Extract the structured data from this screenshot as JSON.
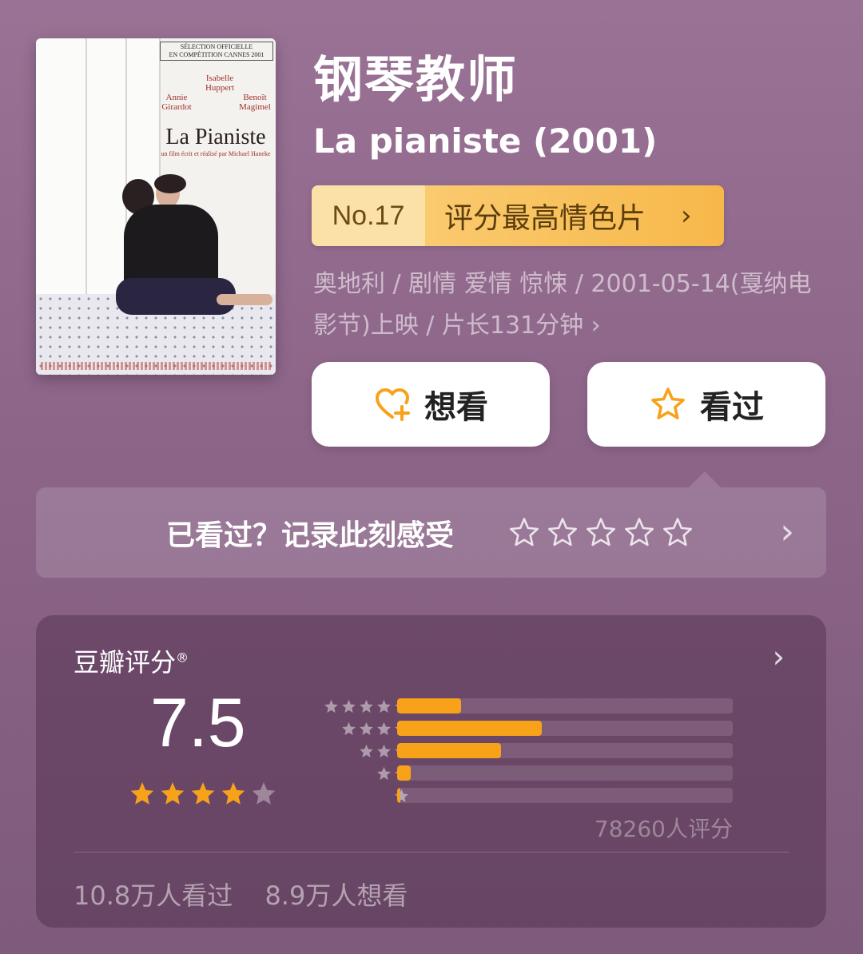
{
  "movie": {
    "title_cn": "钢琴教师",
    "title_original": "La pianiste (2001)",
    "rank_no": "No.17",
    "rank_label": "评分最高情色片",
    "meta": "奥地利 / 剧情 爱情 惊悚 / 2001-05-14(戛纳电影节)上映 / 片长131分钟 ›"
  },
  "poster": {
    "festival_line1": "SÉLECTION OFFICIELLE",
    "festival_line2": "EN COMPÉTITION CANNES 2001",
    "actor1": "Isabelle Huppert",
    "actor2": "Annie Girardot",
    "actor3": "Benoît Magimel",
    "film_title": "La Pianiste",
    "director": "un film écrit et réalisé par Michael Haneke"
  },
  "actions": {
    "wish_label": "想看",
    "seen_label": "看过",
    "wish_icon": "heart-plus-icon",
    "seen_icon": "star-outline-icon"
  },
  "record": {
    "prompt": "已看过？记录此刻感受"
  },
  "rating": {
    "title": "豆瓣评分",
    "registered": "®",
    "score": "7.5",
    "stars": 3.75,
    "distribution": [
      {
        "stars": 5,
        "percent": 19
      },
      {
        "stars": 4,
        "percent": 43
      },
      {
        "stars": 3,
        "percent": 31
      },
      {
        "stars": 2,
        "percent": 4
      },
      {
        "stars": 1,
        "percent": 1
      }
    ],
    "count_text": "78260人评分",
    "seen_text": "10.8万人看过",
    "wish_text": "8.9万人想看"
  },
  "colors": {
    "accent": "#f8a21a",
    "rank_bg": "#f7b84a",
    "background": "#8d6589"
  }
}
